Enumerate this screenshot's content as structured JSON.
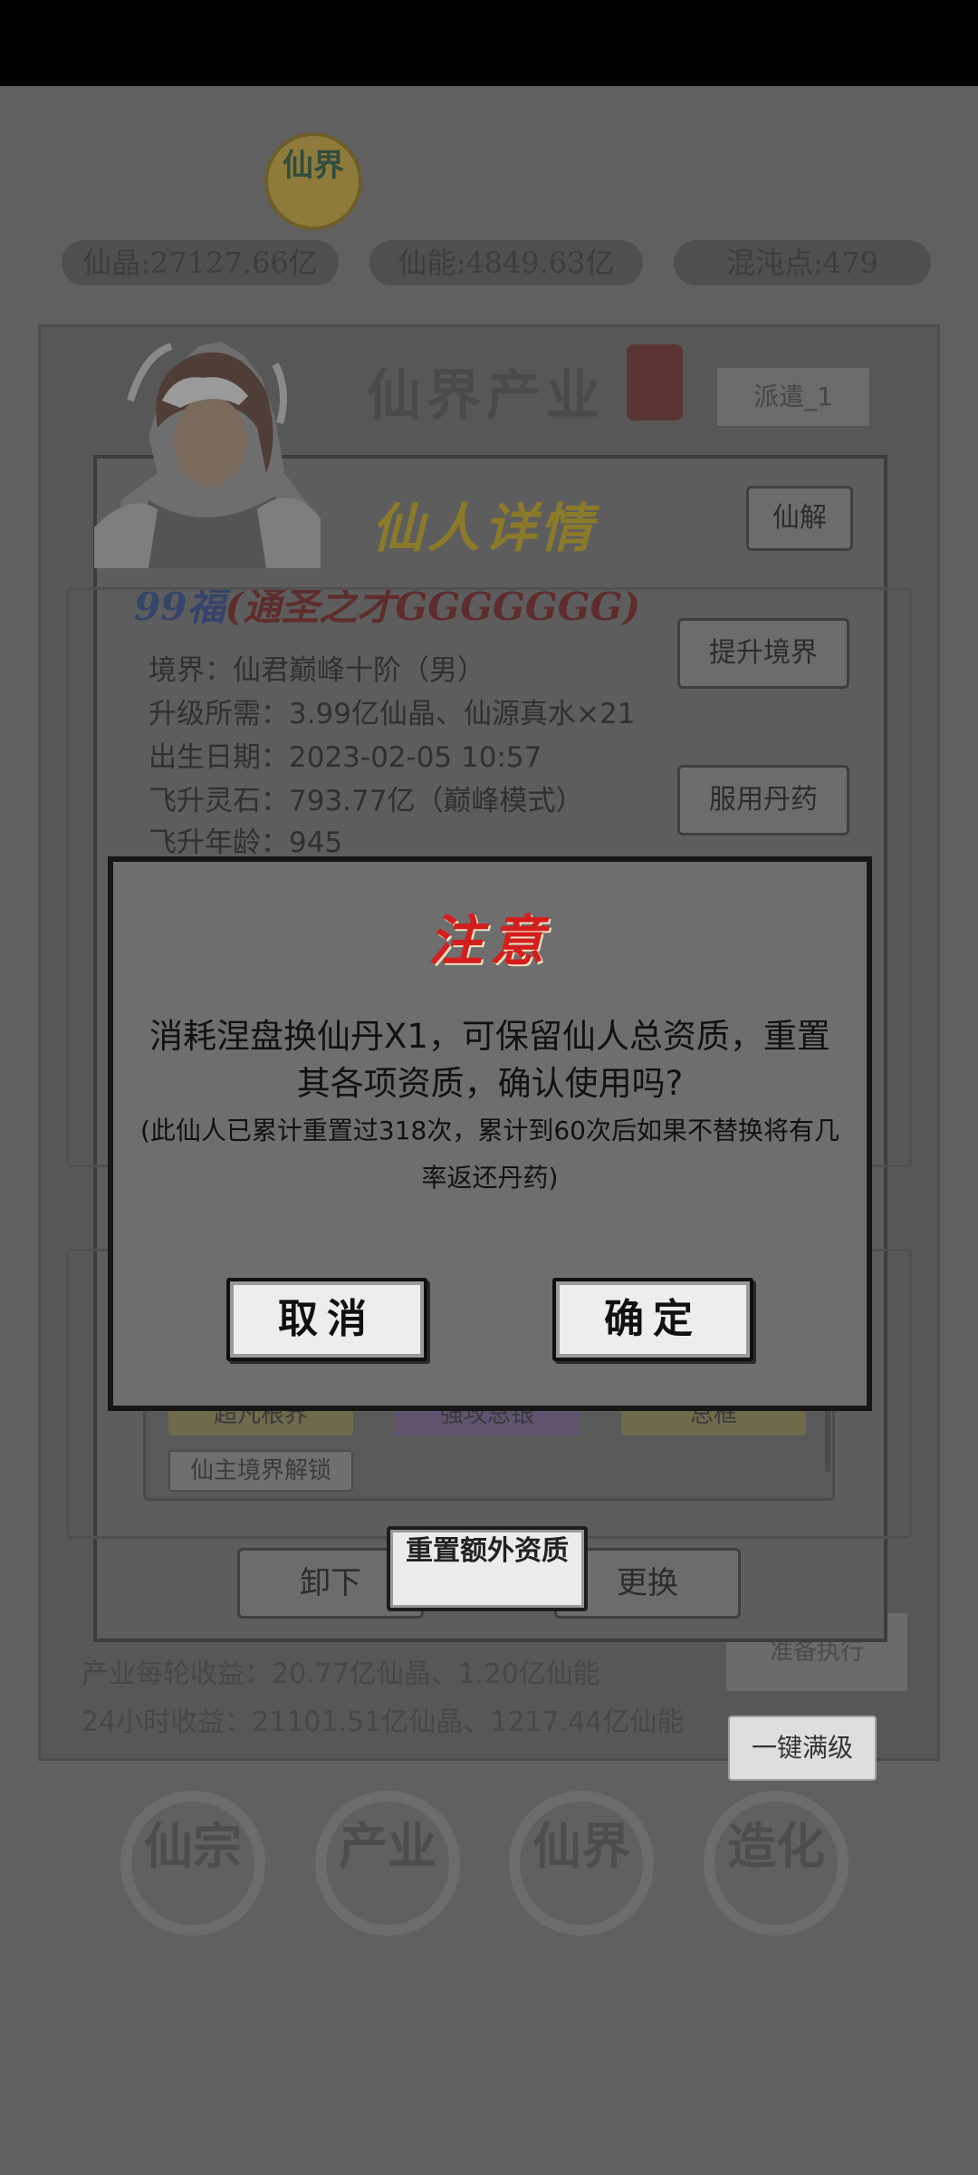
{
  "header": {
    "logo_text": "仙界",
    "crystal": "仙晶:27127.66亿",
    "energy": "仙能:4849.63亿",
    "chaos": "混沌点:479"
  },
  "industry": {
    "title": "仙界产业",
    "dispatch_label": "派遣_1",
    "round_income": "产业每轮收益：20.77亿仙晶、1.20亿仙能",
    "daily_income": "24小时收益：21101.51亿仙晶、1217.44亿仙能",
    "secondary_button": "准备执行",
    "one_click_label": "一键满级"
  },
  "bottom_nav": [
    "仙宗",
    "产业",
    "仙界",
    "造化"
  ],
  "detail": {
    "title": "仙人详情",
    "dissolve_label": "仙解",
    "fortune_prefix": "99福",
    "fortune_talent": "(通圣之才",
    "fortune_rings": "GGGGGGG",
    "fortune_suffix": ")",
    "realm": "境界：仙君巅峰十阶（男）",
    "upgrade_cost": "升级所需：3.99亿仙晶、仙源真水×21",
    "birth_date": "出生日期：2023-02-05 10:57",
    "ascend_stone": "飞升灵石：793.77亿（巅峰模式）",
    "ascend_age": "飞升年龄：945",
    "raise_realm_label": "提升境界",
    "take_pill_label": "服用丹药",
    "tags": [
      "超凡根界",
      "强攻总银",
      "总框"
    ],
    "unlock_tag": "仙主境界解锁",
    "unequip_label": "卸下",
    "replace_label": "更换",
    "reset_extra_label": "重置额外资质"
  },
  "dialog": {
    "title": "注意",
    "message": "消耗涅盘换仙丹X1，可保留仙人总资质，重置其各项资质，确认使用吗?",
    "note": "(此仙人已累计重置过318次，累计到60次后如果不替换将有几率返还丹药)",
    "cancel_label": "取消",
    "confirm_label": "确定"
  }
}
